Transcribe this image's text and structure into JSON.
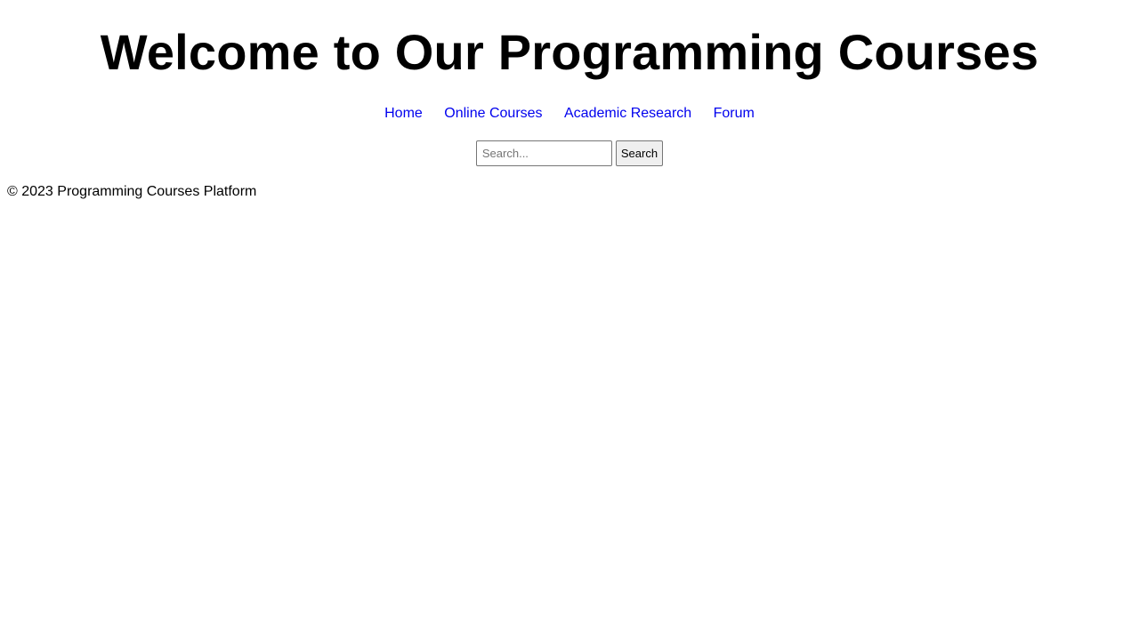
{
  "header": {
    "title": "Welcome to Our Programming Courses"
  },
  "nav": {
    "items": [
      {
        "label": "Home"
      },
      {
        "label": "Online Courses"
      },
      {
        "label": "Academic Research"
      },
      {
        "label": "Forum"
      }
    ],
    "link_color": "#0000ee"
  },
  "search": {
    "placeholder": "Search...",
    "value": "",
    "button_label": "Search"
  },
  "footer": {
    "text": "© 2023 Programming Courses Platform"
  }
}
